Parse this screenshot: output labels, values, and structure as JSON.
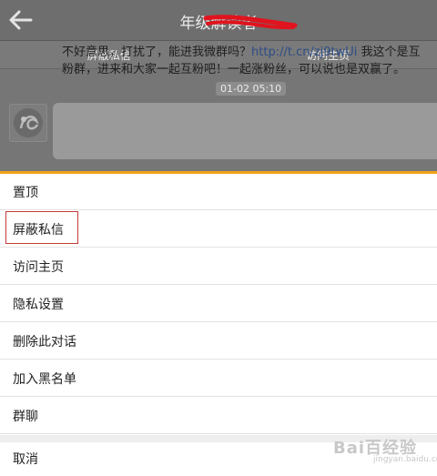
{
  "header": {
    "back_icon": "back-arrow-icon",
    "title": "年级解读者"
  },
  "actions": [
    {
      "label": "屏蔽私信"
    },
    {
      "label": "访问主页"
    }
  ],
  "chat": {
    "time": "01-02 05:10",
    "message_line1_a": "不好意思，打扰了，能进我微群吗？",
    "message_link": "http://t.cn/zj9twUi",
    "message_line1_b": " 我这个是互",
    "message_line2": "粉群，进来和大家一起互粉吧！一起涨粉丝，可以说也是双赢了。"
  },
  "menu": {
    "items": [
      {
        "label": "置顶"
      },
      {
        "label": "屏蔽私信"
      },
      {
        "label": "访问主页"
      },
      {
        "label": "隐私设置"
      },
      {
        "label": "删除此对话"
      },
      {
        "label": "加入黑名单"
      },
      {
        "label": "群聊"
      }
    ],
    "cancel": "取消"
  },
  "watermark": {
    "text": "Bai百经验",
    "sub": "jingyan.baidu.com"
  },
  "colors": {
    "accent": "#f0a21c",
    "highlight_border": "#c43a3a",
    "link": "#2d4d85"
  }
}
